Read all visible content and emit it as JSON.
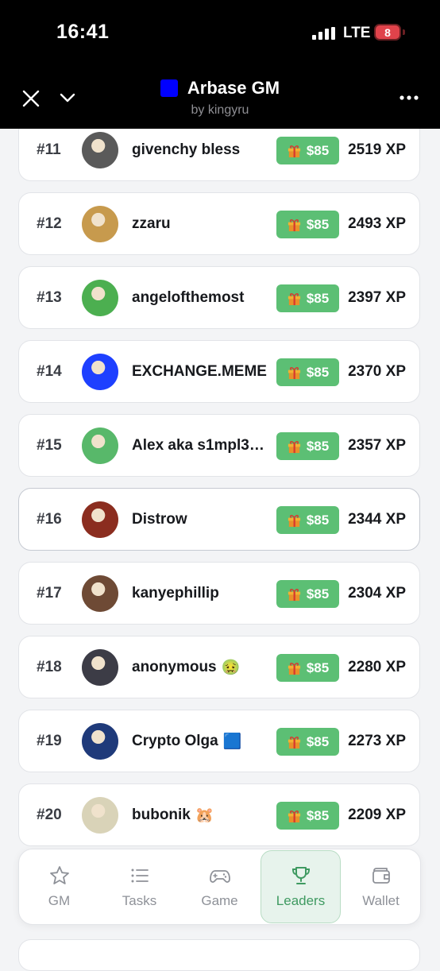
{
  "status_bar": {
    "time": "16:41",
    "network": "LTE",
    "battery": "8"
  },
  "header": {
    "title": "Arbase GM",
    "subtitle": "by kingyru",
    "logo_color": "#0000ff"
  },
  "leaderboard": [
    {
      "rank": "#11",
      "name": "givenchy bless",
      "reward": "$85",
      "xp": "2519 XP",
      "avatar_color": "#5a5a5a"
    },
    {
      "rank": "#12",
      "name": "zzaru",
      "reward": "$85",
      "xp": "2493 XP",
      "avatar_color": "#c79a4d"
    },
    {
      "rank": "#13",
      "name": "angelofthemost",
      "reward": "$85",
      "xp": "2397 XP",
      "avatar_color": "#4caf50"
    },
    {
      "rank": "#14",
      "name": "EXCHANGE.MEME",
      "reward": "$85",
      "xp": "2370 XP",
      "avatar_color": "#1e40ff"
    },
    {
      "rank": "#15",
      "name": "Alex aka s1mpl3…",
      "reward": "$85",
      "xp": "2357 XP",
      "avatar_color": "#58b86a"
    },
    {
      "rank": "#16",
      "name": "Distrow",
      "reward": "$85",
      "xp": "2344 XP",
      "avatar_color": "#8b2d1f"
    },
    {
      "rank": "#17",
      "name": "kanyephillip",
      "reward": "$85",
      "xp": "2304 XP",
      "avatar_color": "#6e4a35"
    },
    {
      "rank": "#18",
      "name": "anonymous",
      "name_emoji": "🤢",
      "reward": "$85",
      "xp": "2280 XP",
      "avatar_color": "#3c3c46"
    },
    {
      "rank": "#19",
      "name": "Crypto Olga",
      "name_emoji": "🟦",
      "reward": "$85",
      "xp": "2273 XP",
      "avatar_color": "#1f3a7a"
    },
    {
      "rank": "#20",
      "name": "bubonik",
      "name_emoji": "🐹",
      "reward": "$85",
      "xp": "2209 XP",
      "avatar_color": "#d9d3b8"
    }
  ],
  "bottom_nav": [
    {
      "label": "GM",
      "icon": "star-icon",
      "active": false
    },
    {
      "label": "Tasks",
      "icon": "list-icon",
      "active": false
    },
    {
      "label": "Game",
      "icon": "gamepad-icon",
      "active": false
    },
    {
      "label": "Leaders",
      "icon": "trophy-icon",
      "active": true
    },
    {
      "label": "Wallet",
      "icon": "wallet-icon",
      "active": false
    }
  ],
  "colors": {
    "reward_badge": "#5cbf74",
    "active_nav": "#3f9a61",
    "background": "#f3f4f6"
  }
}
